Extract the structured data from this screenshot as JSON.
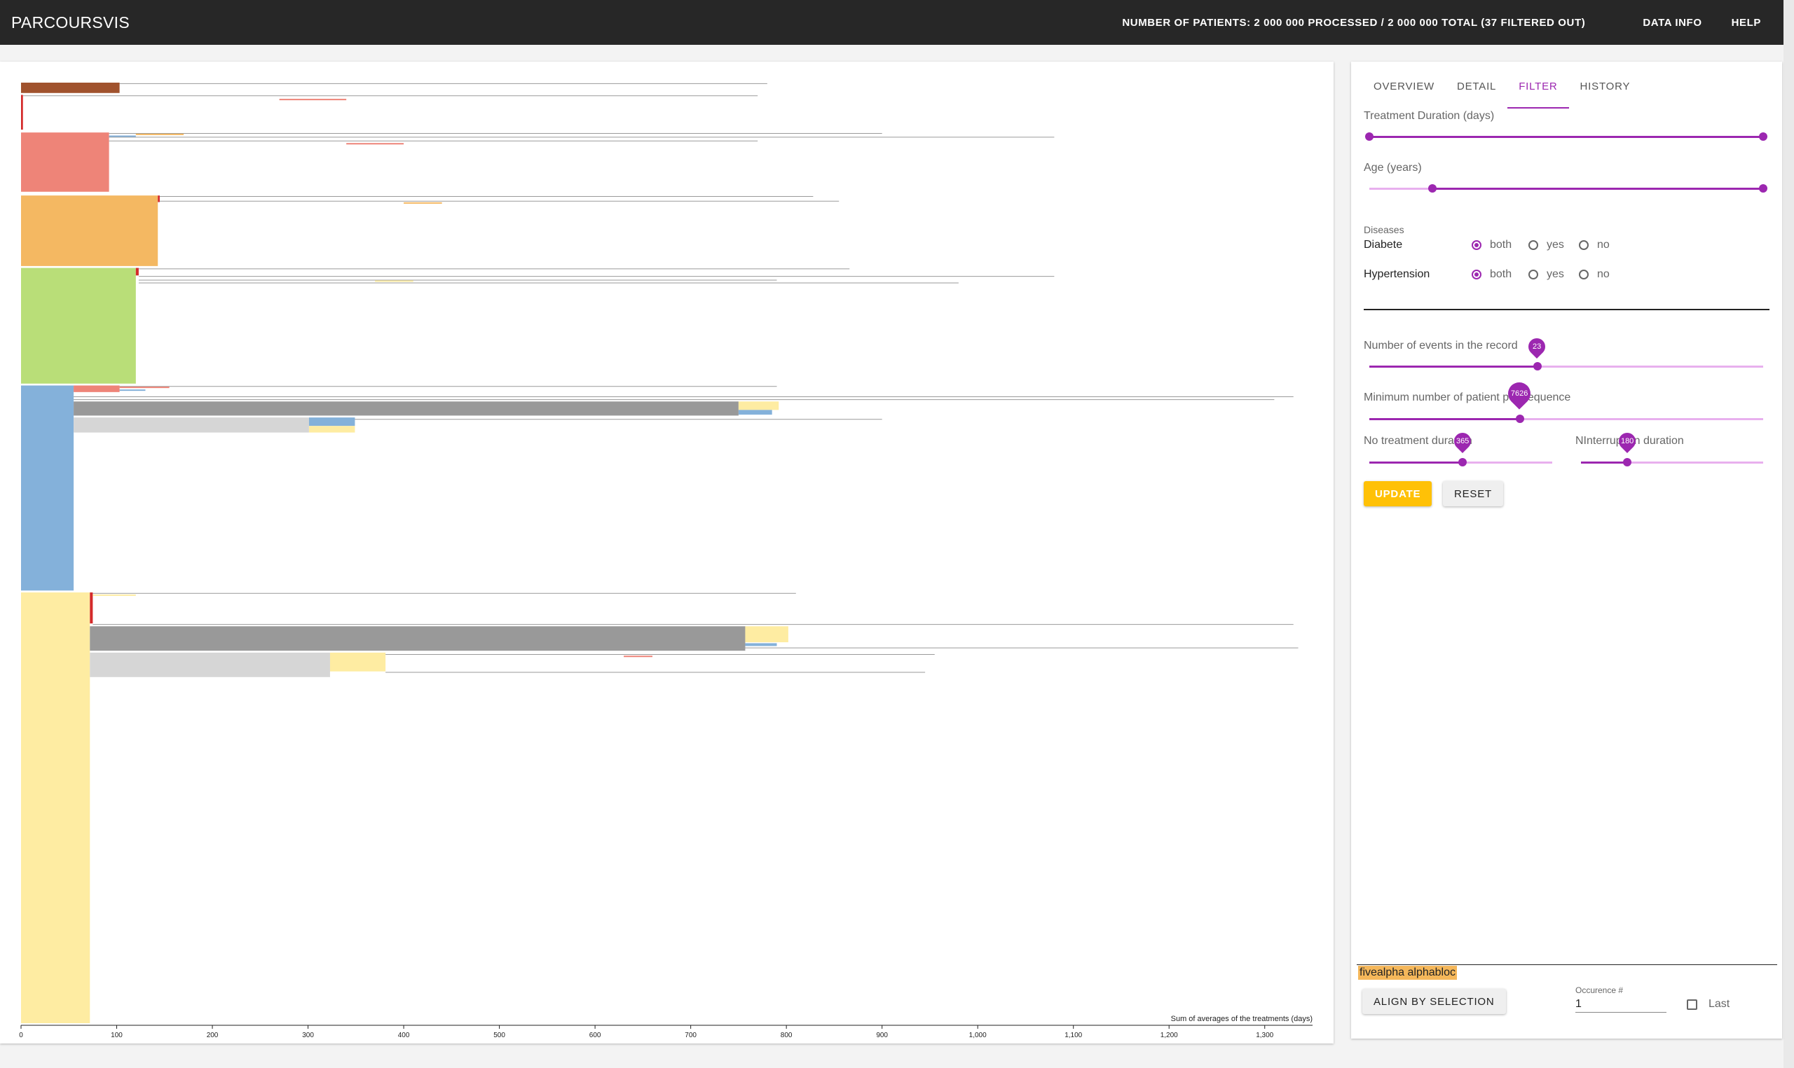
{
  "app": {
    "title": "PARCOURSVIS",
    "status": "NUMBER OF PATIENTS: 2 000 000 PROCESSED / 2 000 000 TOTAL (37 FILTERED OUT)",
    "menu": [
      "DATA INFO",
      "HELP"
    ]
  },
  "tabs": [
    {
      "label": "OVERVIEW",
      "active": false
    },
    {
      "label": "DETAIL",
      "active": false
    },
    {
      "label": "FILTER",
      "active": true
    },
    {
      "label": "HISTORY",
      "active": false
    }
  ],
  "filters": {
    "treatment_duration": {
      "label": "Treatment Duration (days)",
      "range_fraction": [
        0.0,
        1.0
      ]
    },
    "age": {
      "label": "Age (years)",
      "range_fraction": [
        0.16,
        1.0
      ]
    },
    "diseases_heading": "Diseases",
    "diseases": [
      {
        "name": "Diabete",
        "options": [
          "both",
          "yes",
          "no"
        ],
        "selected": "both"
      },
      {
        "name": "Hypertension",
        "options": [
          "both",
          "yes",
          "no"
        ],
        "selected": "both"
      }
    ],
    "events_in_record": {
      "label": "Number of events in the record",
      "value": "23",
      "fraction": 0.43
    },
    "min_patients_per_sequence": {
      "label": "Minimum number of patient per sequence",
      "value": "7626",
      "fraction": 0.38
    },
    "no_treatment_duration": {
      "label": "No treatment duration",
      "value": "365",
      "fraction": 0.51
    },
    "interruption_duration": {
      "label": "NInterruption duration",
      "value": "180",
      "fraction": 0.25
    },
    "update_label": "UPDATE",
    "reset_label": "RESET"
  },
  "selection": {
    "label": "fivealpha alphabloc",
    "align_label": "ALIGN BY SELECTION",
    "occurrence_label": "Occurence #",
    "occurrence_value": "1",
    "last_label": "Last",
    "last_checked": false
  },
  "chart_data": {
    "type": "icicle",
    "xlabel": "Sum of averages of the treatments (days)",
    "xlim": [
      0,
      1350
    ],
    "ticks": [
      0,
      100,
      200,
      300,
      400,
      500,
      600,
      700,
      800,
      900,
      1000,
      1100,
      1200,
      1300
    ],
    "tick_labels": [
      "0",
      "100",
      "200",
      "300",
      "400",
      "500",
      "600",
      "700",
      "800",
      "900",
      "1,000",
      "1,100",
      "1,200",
      "1,300"
    ],
    "colors": {
      "brown": "#a0522d",
      "red": "#d42a2a",
      "salmon": "#ee8478",
      "orange": "#f4b862",
      "green": "#b9de78",
      "blue": "#84b1da",
      "yellow": "#feeca2",
      "dark_gray": "#999999",
      "light_gray": "#d6d6d6"
    },
    "nodes": [
      {
        "color": "brown",
        "x0": 0,
        "x1": 103,
        "y0": 0.0,
        "y1": 0.011
      },
      {
        "color": "red",
        "x0": 0,
        "x1": 2,
        "y0": 0.013,
        "y1": 0.05
      },
      {
        "color": "salmon",
        "x0": 0,
        "x1": 92,
        "y0": 0.053,
        "y1": 0.116
      },
      {
        "color": "orange",
        "x0": 0,
        "x1": 143,
        "y0": 0.12,
        "y1": 0.195
      },
      {
        "color": "green",
        "x0": 0,
        "x1": 120,
        "y0": 0.197,
        "y1": 0.32
      },
      {
        "color": "blue",
        "x0": 0,
        "x1": 55,
        "y0": 0.322,
        "y1": 0.54
      },
      {
        "color": "yellow",
        "x0": 0,
        "x1": 72,
        "y0": 0.542,
        "y1": 1.0
      },
      {
        "color": "red",
        "x0": 143,
        "x1": 145,
        "y0": 0.12,
        "y1": 0.127
      },
      {
        "color": "red",
        "x0": 120,
        "x1": 123,
        "y0": 0.197,
        "y1": 0.205
      },
      {
        "color": "salmon",
        "x0": 55,
        "x1": 103,
        "y0": 0.322,
        "y1": 0.329
      },
      {
        "color": "dark_gray",
        "x0": 55,
        "x1": 750,
        "y0": 0.339,
        "y1": 0.354
      },
      {
        "color": "yellow",
        "x0": 750,
        "x1": 792,
        "y0": 0.339,
        "y1": 0.348
      },
      {
        "color": "blue",
        "x0": 750,
        "x1": 785,
        "y0": 0.348,
        "y1": 0.353
      },
      {
        "color": "light_gray",
        "x0": 55,
        "x1": 301,
        "y0": 0.356,
        "y1": 0.372
      },
      {
        "color": "blue",
        "x0": 301,
        "x1": 349,
        "y0": 0.356,
        "y1": 0.365
      },
      {
        "color": "yellow",
        "x0": 301,
        "x1": 349,
        "y0": 0.365,
        "y1": 0.372
      },
      {
        "color": "red",
        "x0": 72,
        "x1": 75,
        "y0": 0.542,
        "y1": 0.575
      },
      {
        "color": "dark_gray",
        "x0": 72,
        "x1": 757,
        "y0": 0.578,
        "y1": 0.604
      },
      {
        "color": "yellow",
        "x0": 757,
        "x1": 802,
        "y0": 0.578,
        "y1": 0.595
      },
      {
        "color": "blue",
        "x0": 757,
        "x1": 790,
        "y0": 0.596,
        "y1": 0.599
      },
      {
        "color": "light_gray",
        "x0": 72,
        "x1": 323,
        "y0": 0.606,
        "y1": 0.632
      },
      {
        "color": "yellow",
        "x0": 323,
        "x1": 381,
        "y0": 0.606,
        "y1": 0.626
      }
    ],
    "thin_lines": [
      {
        "x0": 103,
        "x1": 780,
        "y": 0.001
      },
      {
        "x0": 2,
        "x1": 770,
        "y": 0.014
      },
      {
        "x0": 92,
        "x1": 900,
        "y": 0.054
      },
      {
        "x0": 92,
        "x1": 1080,
        "y": 0.058
      },
      {
        "x0": 92,
        "x1": 770,
        "y": 0.062
      },
      {
        "x0": 145,
        "x1": 828,
        "y": 0.121
      },
      {
        "x0": 145,
        "x1": 855,
        "y": 0.126
      },
      {
        "x0": 123,
        "x1": 866,
        "y": 0.198
      },
      {
        "x0": 123,
        "x1": 1080,
        "y": 0.206
      },
      {
        "x0": 123,
        "x1": 790,
        "y": 0.21
      },
      {
        "x0": 123,
        "x1": 980,
        "y": 0.213
      },
      {
        "x0": 103,
        "x1": 790,
        "y": 0.323
      },
      {
        "x0": 55,
        "x1": 1330,
        "y": 0.334
      },
      {
        "x0": 55,
        "x1": 1310,
        "y": 0.337
      },
      {
        "x0": 349,
        "x1": 900,
        "y": 0.358
      },
      {
        "x0": 75,
        "x1": 810,
        "y": 0.543
      },
      {
        "x0": 75,
        "x1": 1330,
        "y": 0.576
      },
      {
        "x0": 75,
        "x1": 1335,
        "y": 0.601
      },
      {
        "x0": 381,
        "x1": 955,
        "y": 0.608
      },
      {
        "x0": 381,
        "x1": 945,
        "y": 0.627
      }
    ],
    "accent_segments": [
      {
        "color": "salmon",
        "x0": 270,
        "x1": 340,
        "y": 0.018
      },
      {
        "color": "blue",
        "x0": 92,
        "x1": 120,
        "y": 0.057
      },
      {
        "color": "orange",
        "x0": 120,
        "x1": 170,
        "y": 0.055
      },
      {
        "color": "salmon",
        "x0": 340,
        "x1": 400,
        "y": 0.065
      },
      {
        "color": "orange",
        "x0": 400,
        "x1": 440,
        "y": 0.128
      },
      {
        "color": "yellow",
        "x0": 370,
        "x1": 410,
        "y": 0.211
      },
      {
        "color": "salmon",
        "x0": 103,
        "x1": 155,
        "y": 0.324
      },
      {
        "color": "blue",
        "x0": 103,
        "x1": 130,
        "y": 0.327
      },
      {
        "color": "yellow",
        "x0": 75,
        "x1": 120,
        "y": 0.545
      },
      {
        "color": "salmon",
        "x0": 630,
        "x1": 660,
        "y": 0.61
      }
    ]
  }
}
